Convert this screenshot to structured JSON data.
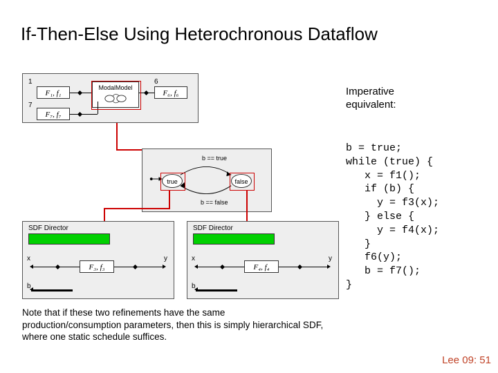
{
  "title": "If-Then-Else Using Heterochronous Dataflow",
  "imperative_header_l1": "Imperative",
  "imperative_header_l2": "equivalent:",
  "code": "b = true;\nwhile (true) {\n   x = f1();\n   if (b) {\n     y = f3(x);\n   } else {\n     y = f4(x);\n   }\n   f6(y);\n   b = f7();\n}",
  "note": "Note that if these two refinements have the same production/consumption parameters, then this is simply hierarchical SDF, where one static schedule suffices.",
  "footer": "Lee 09: 51",
  "top_diagram": {
    "port1_rate": "1",
    "port6_rate": "6",
    "port7_rate": "7",
    "f1": "F₁,  f₁",
    "f6": "F₆,  f₆",
    "f7": "F₇,  f₇",
    "modal": "ModalModel"
  },
  "mid_diagram": {
    "state_true": "true",
    "state_false": "false",
    "guard_true": "b == true",
    "guard_false": "b == false"
  },
  "sdf_left": {
    "director": "SDF Director",
    "x": "x",
    "y": "y",
    "b": "b",
    "actor": "F₃,  f₃"
  },
  "sdf_right": {
    "director": "SDF Director",
    "x": "x",
    "y": "y",
    "b": "b",
    "actor": "F₄,  f₄"
  }
}
